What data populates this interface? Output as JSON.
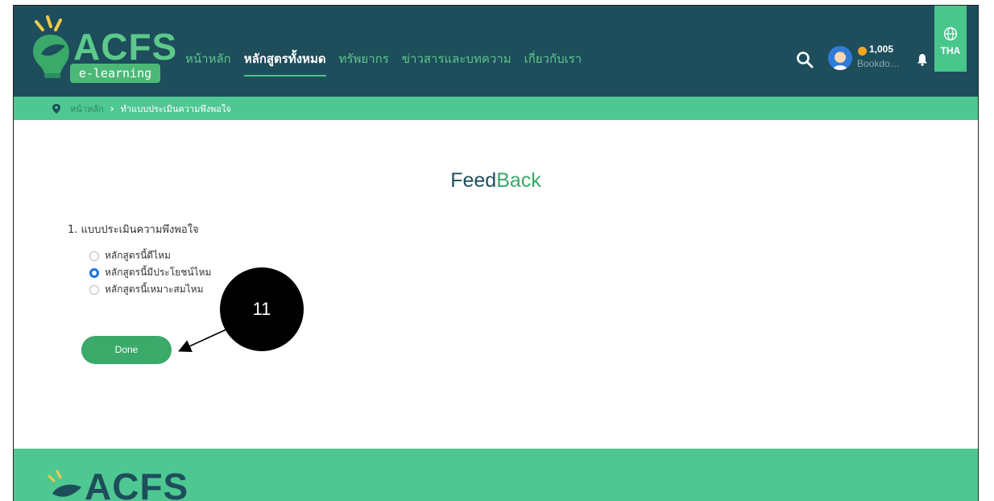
{
  "brand": {
    "name": "ACFS",
    "subtitle": "e-learning"
  },
  "nav": {
    "items": [
      {
        "label": "หน้าหลัก"
      },
      {
        "label": "หลักสูตรทั้งหมด"
      },
      {
        "label": "ทรัพยากร"
      },
      {
        "label": "ข่าวสารและบทความ"
      },
      {
        "label": "เกี่ยวกับเรา"
      }
    ],
    "active_index": 1
  },
  "user": {
    "coins": "1,005",
    "name": "Bookdos..."
  },
  "language": {
    "label": "THA"
  },
  "breadcrumb": {
    "home": "หน้าหลัก",
    "current": "ทำแบบประเมินความพึงพอใจ"
  },
  "page": {
    "title_part1": "Feed",
    "title_part2": "Back"
  },
  "survey": {
    "question": "1. แบบประเมินความพึงพอใจ",
    "options": [
      {
        "label": "หลักสูตรนี้ดีไหม",
        "checked": false
      },
      {
        "label": "หลักสูตรนี้มีประโยชน์ไหม",
        "checked": true
      },
      {
        "label": "หลักสูตรนี้เหมาะสมไหม",
        "checked": false
      }
    ],
    "submit_label": "Done"
  },
  "annotation": {
    "number": "11"
  },
  "footer": {
    "brand": "ACFS"
  },
  "colors": {
    "header_bg": "#1e4d5c",
    "accent_green": "#4fc792",
    "button_green": "#3aa969",
    "radio_selected": "#1a6fe0"
  }
}
